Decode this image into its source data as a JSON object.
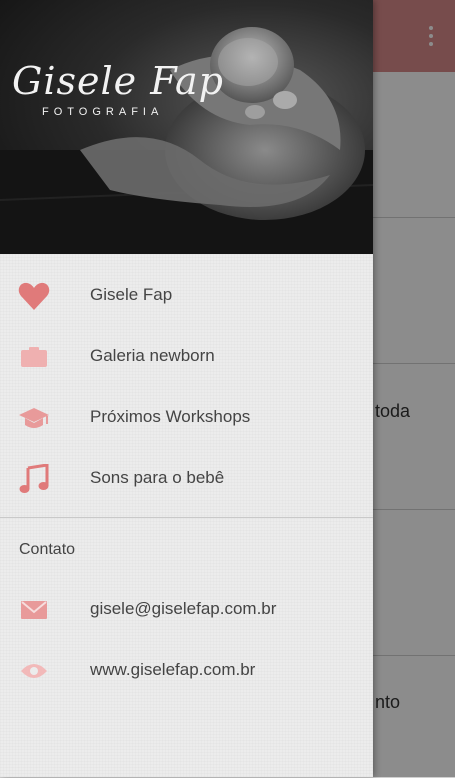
{
  "colors": {
    "accent": "#e58b8b",
    "appbar": "#d98a8a"
  },
  "background_app": {
    "card_texts": [
      "toda",
      "nto"
    ]
  },
  "drawer": {
    "header": {
      "brand_name": "Gisele Fap",
      "brand_sub": "FOTOGRAFIA"
    },
    "items": [
      {
        "label": "Gisele Fap",
        "icon": "heart-icon"
      },
      {
        "label": "Galeria newborn",
        "icon": "camera-icon"
      },
      {
        "label": "Próximos Workshops",
        "icon": "graduation-cap-icon"
      },
      {
        "label": "Sons para o bebê",
        "icon": "music-note-icon"
      }
    ],
    "contact_title": "Contato",
    "contacts": [
      {
        "label": "gisele@giselefap.com.br",
        "icon": "mail-icon"
      },
      {
        "label": "www.giselefap.com.br",
        "icon": "eye-icon"
      }
    ]
  }
}
